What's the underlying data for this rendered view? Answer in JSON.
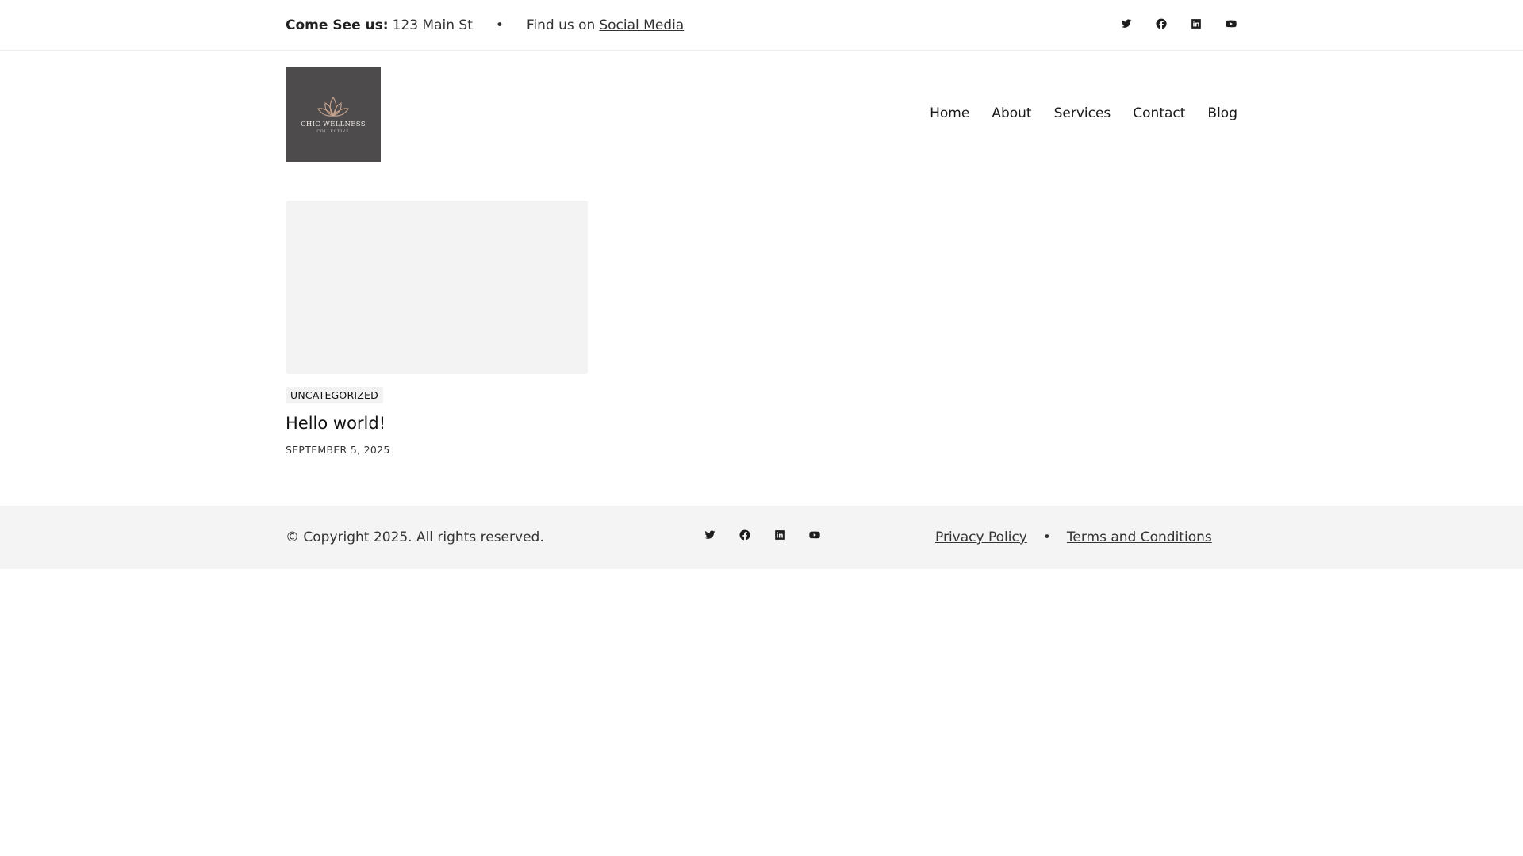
{
  "topbar": {
    "address_label": "Come See us:",
    "address_value": "123 Main St",
    "separator": "•",
    "social_prefix": "Find us on",
    "social_link": "Social Media",
    "social_icons": [
      "twitter-icon",
      "facebook-icon",
      "linkedin-icon",
      "youtube-icon"
    ]
  },
  "header": {
    "logo_name": "CHIC WELLNESS",
    "logo_sub": "COLLECTIVE",
    "nav": [
      "Home",
      "About",
      "Services",
      "Contact",
      "Blog"
    ]
  },
  "posts": [
    {
      "category": "UNCATEGORIZED",
      "title": "Hello world!",
      "date": "SEPTEMBER 5, 2025"
    }
  ],
  "footer": {
    "copyright": "© Copyright 2025. All rights reserved.",
    "links": [
      "Privacy Policy",
      "Terms and Conditions"
    ],
    "separator": "•",
    "social_icons": [
      "twitter-icon",
      "facebook-icon",
      "linkedin-icon",
      "youtube-icon"
    ]
  },
  "colors": {
    "logo_background": "#4d4b4c",
    "logo_accent": "#c9a58f",
    "footer_background": "#f4f4f4",
    "thumbnail_placeholder": "#f3f3f3"
  }
}
